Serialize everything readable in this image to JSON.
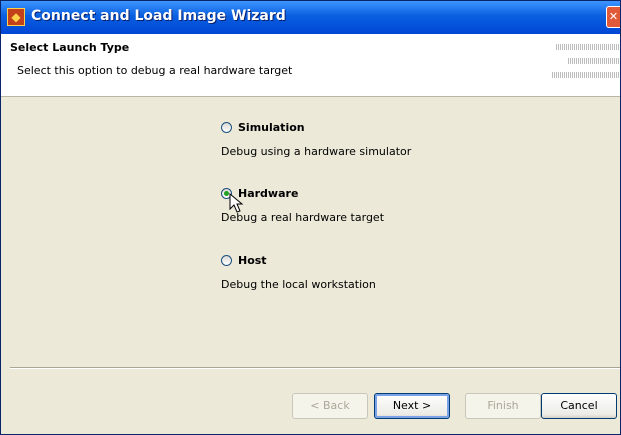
{
  "window": {
    "title": "Connect and Load Image Wizard",
    "app_icon": "wizard-app-icon",
    "close_glyph": "✕"
  },
  "header": {
    "title": "Select Launch Type",
    "description": "Select this option to debug a real hardware target"
  },
  "options": [
    {
      "label": "Simulation",
      "description": "Debug using a hardware simulator",
      "selected": false
    },
    {
      "label": "Hardware",
      "description": "Debug a real hardware target",
      "selected": true
    },
    {
      "label": "Host",
      "description": "Debug the local workstation",
      "selected": false
    }
  ],
  "buttons": {
    "back": {
      "label": "< Back",
      "enabled": false
    },
    "next": {
      "label": "Next >",
      "enabled": true
    },
    "finish": {
      "label": "Finish",
      "enabled": false
    },
    "cancel": {
      "label": "Cancel",
      "enabled": true
    }
  },
  "colors": {
    "titlebar": "#0a5fe0",
    "radio_selected": "#21a121"
  }
}
